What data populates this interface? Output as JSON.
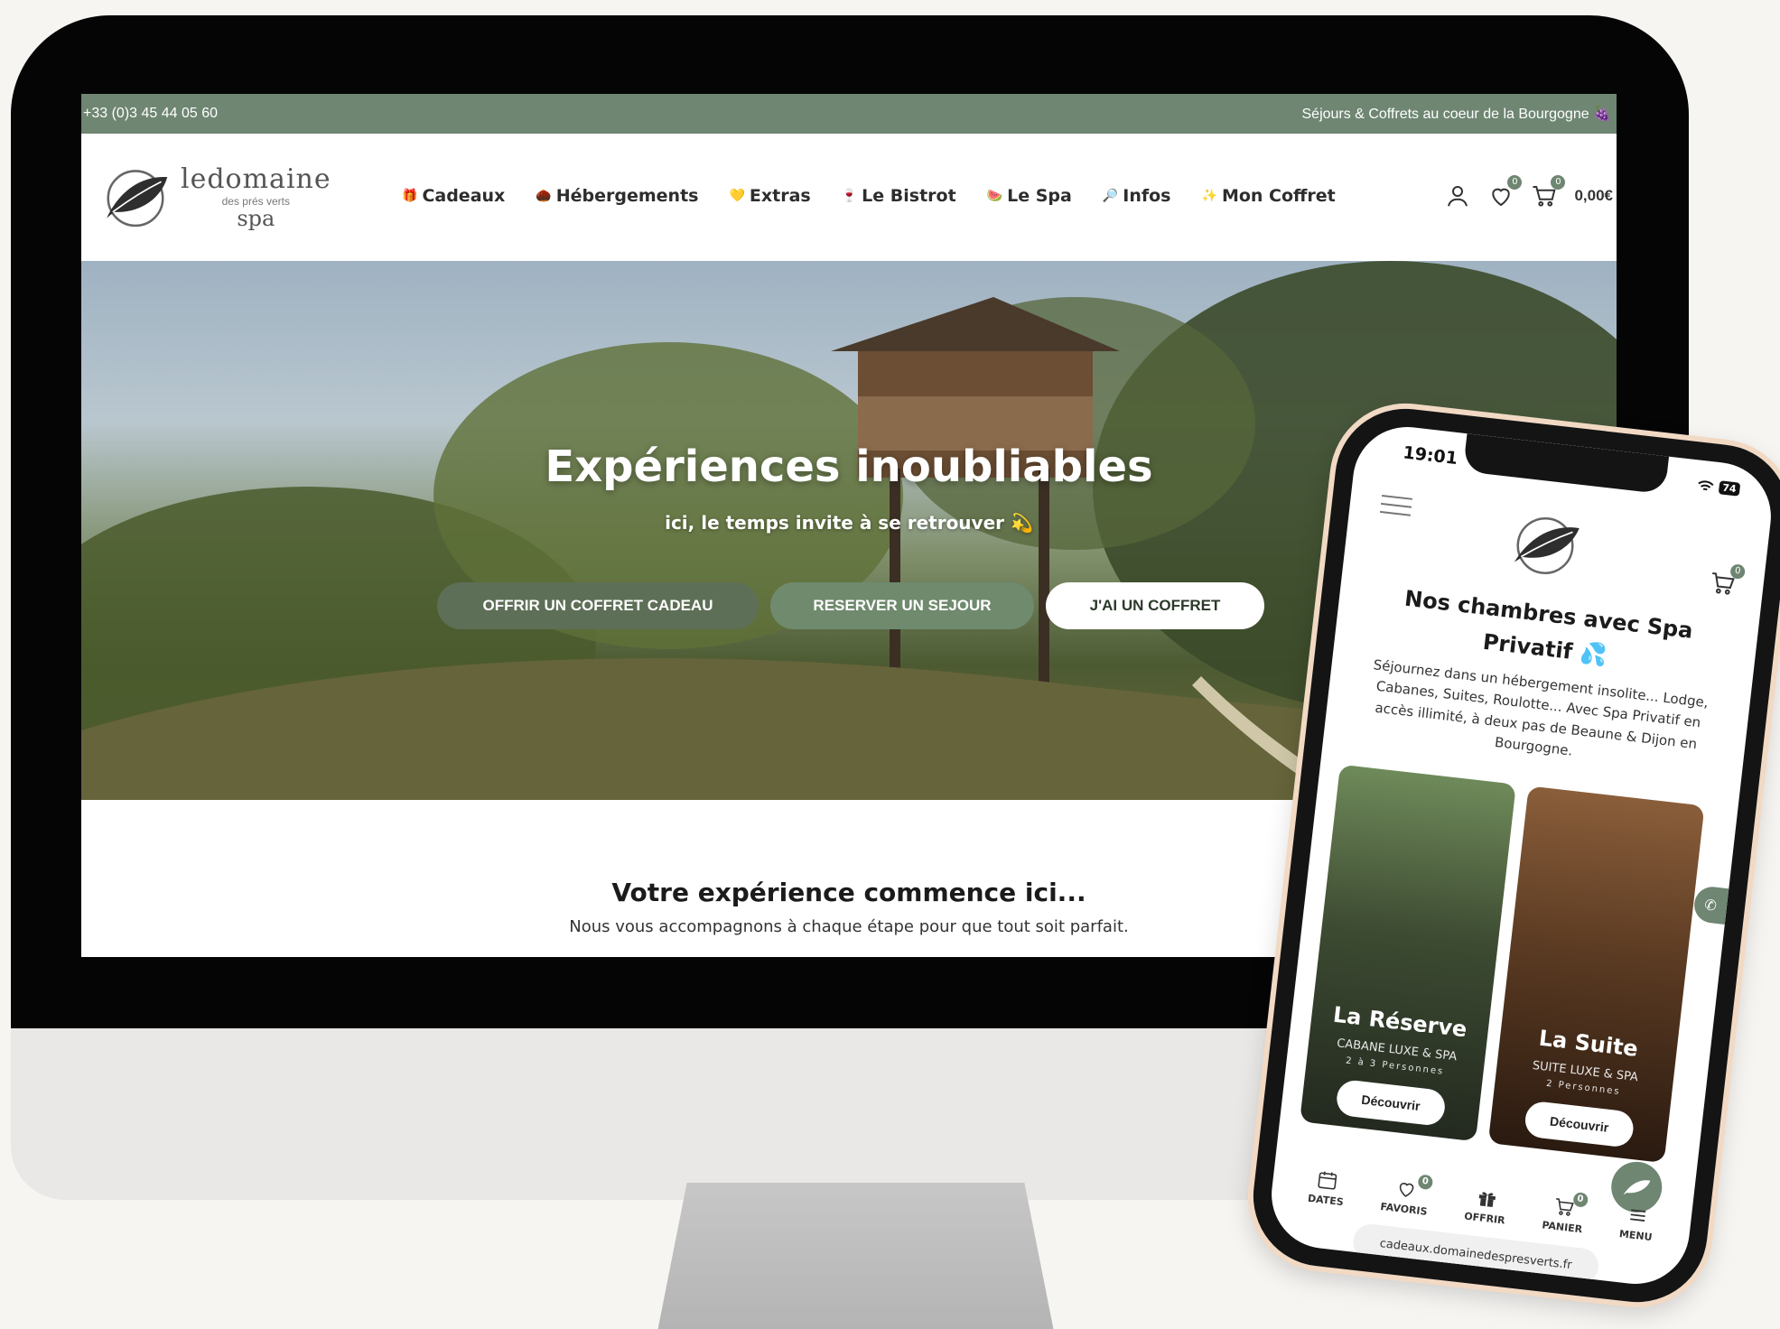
{
  "topbar": {
    "phone": "+33 (0)3 45 44 05 60",
    "tagline": "Séjours & Coffrets au coeur de la Bourgogne 🍇"
  },
  "logo": {
    "line1": "ledomaine",
    "line2": "des prés verts",
    "line3": "spa"
  },
  "nav": [
    {
      "icon": "🎁",
      "label": "Cadeaux"
    },
    {
      "icon": "🌰",
      "label": "Hébergements"
    },
    {
      "icon": "💛",
      "label": "Extras"
    },
    {
      "icon": "🍷",
      "label": "Le Bistrot"
    },
    {
      "icon": "🍉",
      "label": "Le Spa"
    },
    {
      "icon": "🔎",
      "label": "Infos"
    },
    {
      "icon": "✨",
      "label": "Mon Coffret"
    }
  ],
  "header_icons": {
    "wishlist_count": "0",
    "cart_count": "0",
    "cart_total": "0,00€"
  },
  "hero": {
    "title": "Expériences inoubliables",
    "subtitle": "ici, le temps invite à se retrouver 💫",
    "buttons": [
      "OFFRIR UN COFFRET CADEAU",
      "RESERVER UN SEJOUR",
      "J'AI UN COFFRET"
    ]
  },
  "section": {
    "title": "Votre expérience commence ici...",
    "subtitle": "Nous vous accompagnons à chaque étape pour que tout soit parfait."
  },
  "phone": {
    "time": "19:01",
    "battery": "74",
    "cart_count": "0",
    "title": "Nos chambres avec Spa Privatif 💦",
    "description": "Séjournez dans un hébergement insolite... Lodge, Cabanes, Suites, Roulotte... Avec Spa Privatif en accès illimité, à deux pas de Beaune & Dijon en Bourgogne.",
    "cards": [
      {
        "name": "La Réserve",
        "type": "CABANE LUXE & SPA",
        "persons": "2 à 3 Personnes",
        "button": "Découvrir"
      },
      {
        "name": "La Suite",
        "type": "SUITE LUXE & SPA",
        "persons": "2 Personnes",
        "button": "Découvrir"
      }
    ],
    "tabs": [
      {
        "label": "DATES",
        "badge": ""
      },
      {
        "label": "FAVORIS",
        "badge": "0"
      },
      {
        "label": "OFFRIR",
        "badge": ""
      },
      {
        "label": "PANIER",
        "badge": "0"
      },
      {
        "label": "MENU",
        "badge": ""
      }
    ],
    "url": "cadeaux.domainedespresverts.fr"
  },
  "colors": {
    "brand_green": "#6e8672",
    "dark_green": "#5e6f57"
  }
}
